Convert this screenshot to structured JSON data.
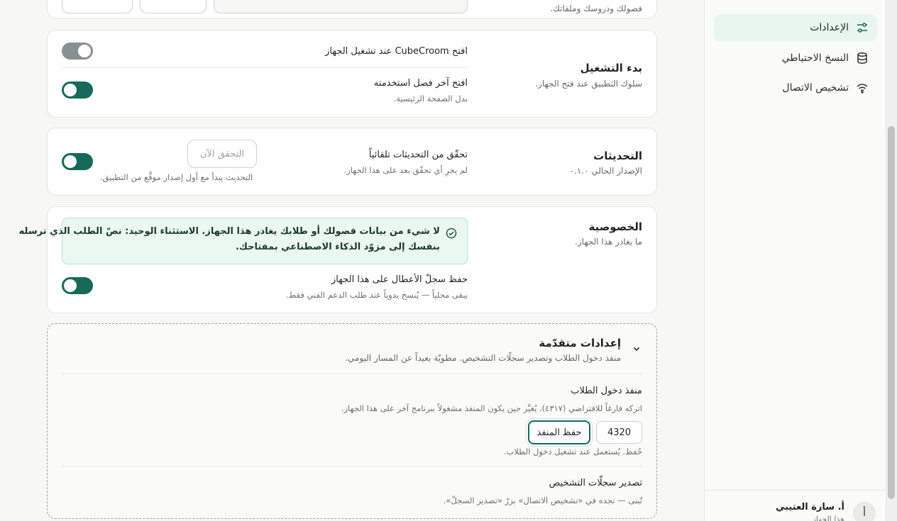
{
  "sidebar": {
    "items": [
      {
        "label": "الإعدادات",
        "icon": "sliders-icon",
        "active": true
      },
      {
        "label": "النسخ الاحتياطي",
        "icon": "database-icon",
        "active": false
      },
      {
        "label": "تشخيص الاتصال",
        "icon": "wifi-icon",
        "active": false
      }
    ],
    "user": {
      "initial": "أ",
      "name": "أ. سارة العتيبي",
      "subtitle": "هذا الجهاز"
    }
  },
  "top_partial": {
    "subtitle": "فصولك ودروسك وملفاتك."
  },
  "startup": {
    "title": "بدء التشغيل",
    "subtitle": "سلوك التطبيق عند فتح الجهاز.",
    "open_on_boot": {
      "label": "افتح CubeCroom عند تشغيل الجهاز",
      "enabled": true,
      "disabled": true
    },
    "open_last_class": {
      "label": "افتح آخر فصل استخدمته",
      "sub": "بدل الصفحة الرئيسية.",
      "enabled": false
    }
  },
  "updates": {
    "title": "التحديثات",
    "subtitle": "الإصدار الحالي ٠.١.٠",
    "auto_check": {
      "label": "تحقّق من التحديثات تلقائياً",
      "sub": "لم يجرِ أي تحقّق بعد على هذا الجهاز.",
      "enabled": false
    },
    "check_now_label": "التحقق الآن",
    "check_now_note": "التحديث يبدأ مع أول إصدار موقَّع من التطبيق."
  },
  "privacy": {
    "title": "الخصوصية",
    "subtitle": "ما يغادر هذا الجهاز.",
    "notice_line1": "لا شيء من بيانات فصولك أو طلابك يغادر هذا الجهاز. الاستثناء الوحيد: نصّ الطلب الذي ترسله",
    "notice_line2": "بنفسك إلى مزوّد الذكاء الاصطناعي بمفتاحك.",
    "crash_log": {
      "label": "حفظ سجلّ الأعطال على هذا الجهاز",
      "sub": "يبقى محلياً — يُنسخ يدوياً عند طلب الدعم الفني فقط.",
      "enabled": false
    }
  },
  "advanced": {
    "title": "إعدادات متقدّمة",
    "subtitle": "منفذ دخول الطلاب وتصدير سجلّات التشخيص. مطويّة بعيداً عن المسار اليومي.",
    "port": {
      "label": "منفذ دخول الطلاب",
      "help": "اتركه فارغاً للافتراضي (٤٣١٧). يُغيَّر حين يكون المنفذ مشغولاً ببرنامج آخر على هذا الجهاز.",
      "value": "4320",
      "save_label": "حفظ المنفذ",
      "status": "حُفظ. يُستعمل عند تشغيل دخول الطلاب."
    },
    "export_logs": {
      "label": "تصدير سجلّات التشخيص",
      "sub": "تُبنى — تجده في «تشخيص الاتصال» بزرّ «تصدير السجلّ»."
    }
  },
  "colors": {
    "accent": "#17695a",
    "active_nav_bg": "#e8f6ef",
    "notice_bg": "#eaf8f1"
  }
}
